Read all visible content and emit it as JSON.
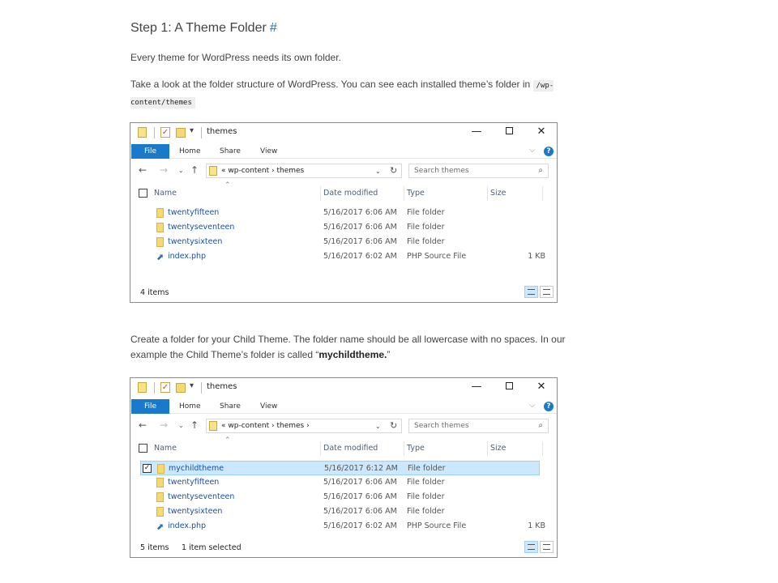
{
  "heading": {
    "text": "Step 1: A Theme Folder",
    "anchor": "#"
  },
  "para1": "Every theme for WordPress needs its own folder.",
  "para2": {
    "text": "Take a look at the folder structure of WordPress. You can see each installed theme’s folder in ",
    "code": "/wp-content/themes"
  },
  "para3": {
    "text1": "Create a folder for your Child Theme. The folder name should be all lowercase with no spaces. In our example the Child Theme’s folder is called “",
    "bold": "mychildtheme.",
    "text2": "”"
  },
  "explorer1": {
    "title": "themes",
    "tabs": [
      "File",
      "Home",
      "Share",
      "View"
    ],
    "address": "«  wp-content  ›  themes",
    "search_placeholder": "Search themes",
    "columns": [
      "Name",
      "Date modified",
      "Type",
      "Size"
    ],
    "rows": [
      {
        "name": "twentyfifteen",
        "date": "5/16/2017 6:06 AM",
        "type": "File folder",
        "size": ""
      },
      {
        "name": "twentyseventeen",
        "date": "5/16/2017 6:06 AM",
        "type": "File folder",
        "size": ""
      },
      {
        "name": "twentysixteen",
        "date": "5/16/2017 6:06 AM",
        "type": "File folder",
        "size": ""
      },
      {
        "name": "index.php",
        "date": "5/16/2017 6:02 AM",
        "type": "PHP Source File",
        "size": "1 KB"
      }
    ],
    "status": "4 items",
    "status_selected": ""
  },
  "explorer2": {
    "title": "themes",
    "tabs": [
      "File",
      "Home",
      "Share",
      "View"
    ],
    "address": "«  wp-content  ›  themes  ›",
    "search_placeholder": "Search themes",
    "columns": [
      "Name",
      "Date modified",
      "Type",
      "Size"
    ],
    "rows": [
      {
        "name": "mychildtheme",
        "date": "5/16/2017 6:12 AM",
        "type": "File folder",
        "size": "",
        "selected": true
      },
      {
        "name": "twentyfifteen",
        "date": "5/16/2017 6:06 AM",
        "type": "File folder",
        "size": ""
      },
      {
        "name": "twentyseventeen",
        "date": "5/16/2017 6:06 AM",
        "type": "File folder",
        "size": ""
      },
      {
        "name": "twentysixteen",
        "date": "5/16/2017 6:06 AM",
        "type": "File folder",
        "size": ""
      },
      {
        "name": "index.php",
        "date": "5/16/2017 6:02 AM",
        "type": "PHP Source File",
        "size": "1 KB"
      }
    ],
    "status": "5 items",
    "status_selected": "1 item selected"
  },
  "colors": {
    "accent": "#1979ca",
    "link": "#1a50a8",
    "selection": "#cce8ff"
  }
}
